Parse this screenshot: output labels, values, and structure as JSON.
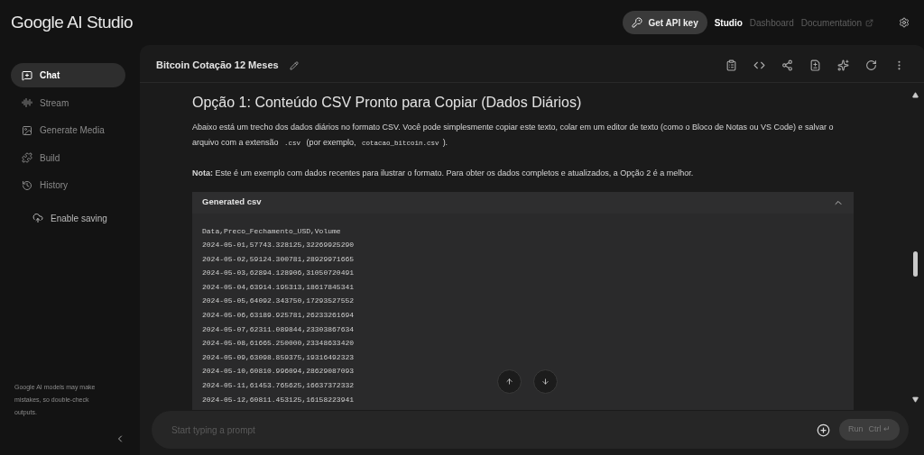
{
  "app": {
    "title": "Google AI Studio"
  },
  "top_nav": {
    "api_button": "Get API key",
    "links": [
      {
        "label": "Studio",
        "selected": true,
        "external": false
      },
      {
        "label": "Dashboard",
        "selected": false,
        "external": false
      },
      {
        "label": "Documentation",
        "selected": false,
        "external": true
      }
    ]
  },
  "sidebar": {
    "items": [
      {
        "label": "Chat",
        "kind": "chat",
        "selected": true
      },
      {
        "label": "Stream",
        "kind": "stream",
        "selected": false
      },
      {
        "label": "Generate Media",
        "kind": "media",
        "selected": false
      },
      {
        "label": "Build",
        "kind": "build",
        "selected": false
      },
      {
        "label": "History",
        "kind": "history",
        "selected": false
      }
    ],
    "saving": "Enable saving",
    "disclaimer": "Google AI models may make mistakes, so double-check outputs."
  },
  "chat": {
    "title": "Bitcoin Cotação 12 Meses",
    "heading": "Opção 1: Conteúdo CSV Pronto para Copiar (Dados Diários)",
    "paragraph": [
      {
        "kind": "text",
        "text": "Abaixo está um trecho dos dados diários no formato CSV. Você pode simplesmente copiar este texto, colar em um editor de texto (como o Bloco de Notas ou VS Code) e salvar o arquivo com a extensão "
      },
      {
        "kind": "code",
        "text": ".csv"
      },
      {
        "kind": "text",
        "text": " (por exemplo, "
      },
      {
        "kind": "code",
        "text": "cotacao_bitcoin.csv"
      },
      {
        "kind": "text",
        "text": ")."
      }
    ],
    "note": "**Nota:** Este é um exemplo com dados recentes para ilustrar o formato. Para obter os dados completos e atualizados, a Opção 2 é a melhor.",
    "code_block": {
      "title": "Generated csv",
      "expanded": true,
      "lines": [
        "Data,Preco_Fechamento_USD,Volume",
        "2024-05-01,57743.328125,32269925290",
        "2024-05-02,59124.300781,28929971665",
        "2024-05-03,62894.128906,31050720491",
        "2024-05-04,63914.195313,18617845341",
        "2024-05-05,64092.343750,17293527552",
        "2024-05-06,63189.925781,26233261694",
        "2024-05-07,62311.089844,23303867634",
        "2024-05-08,61665.250000,23348633420",
        "2024-05-09,63098.859375,19316492323",
        "2024-05-10,60810.996094,28629087093",
        "2024-05-11,61453.765625,16637372332",
        "2024-05-12,60811.453125,16158223941"
      ]
    }
  },
  "prompt": {
    "placeholder": "Start typing a prompt",
    "run": "Run",
    "shortcut": "Ctrl ↵"
  }
}
